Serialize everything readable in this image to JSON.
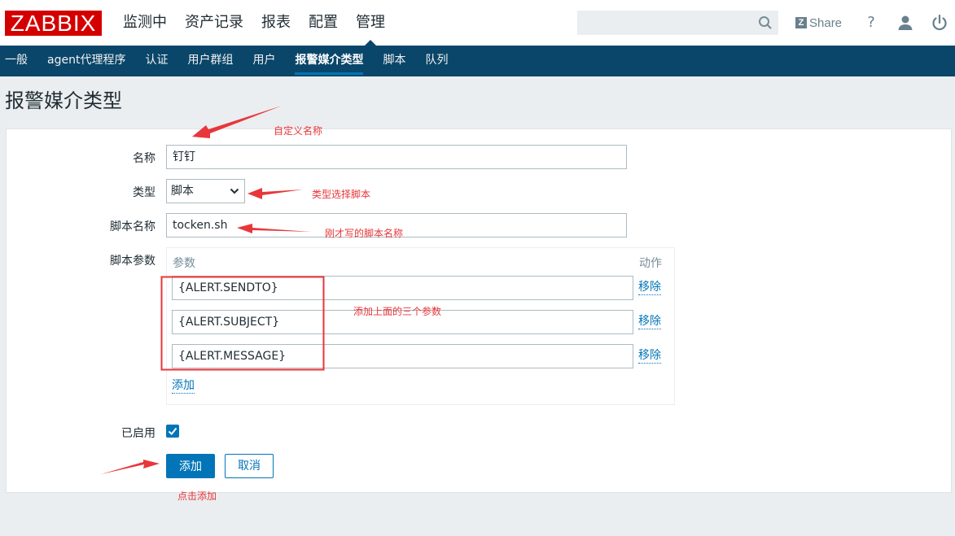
{
  "header": {
    "logo": "ZABBIX",
    "menu": [
      "监测中",
      "资产记录",
      "报表",
      "配置",
      "管理"
    ],
    "active_menu": "管理",
    "search_placeholder": "",
    "share_label": "Share",
    "help_label": "?"
  },
  "subnav": {
    "items": [
      "一般",
      "agent代理程序",
      "认证",
      "用户群组",
      "用户",
      "报警媒介类型",
      "脚本",
      "队列"
    ],
    "active": "报警媒介类型"
  },
  "page_title": "报警媒介类型",
  "form": {
    "name_label": "名称",
    "name_value": "钉钉",
    "type_label": "类型",
    "type_value": "脚本",
    "script_name_label": "脚本名称",
    "script_name_value": "tocken.sh",
    "script_params_label": "脚本参数",
    "params_header": "参数",
    "action_header": "动作",
    "params": [
      {
        "value": "{ALERT.SENDTO}",
        "remove": "移除"
      },
      {
        "value": "{ALERT.SUBJECT}",
        "remove": "移除"
      },
      {
        "value": "{ALERT.MESSAGE}",
        "remove": "移除"
      }
    ],
    "add_param_label": "添加",
    "enabled_label": "已启用",
    "enabled": true,
    "add_button": "添加",
    "cancel_button": "取消"
  },
  "annotations": {
    "custom_name": "自定义名称",
    "type_select": "类型选择脚本",
    "script_name": "刚才写的脚本名称",
    "add_params": "添加上面的三个参数",
    "click_add": "点击添加",
    "color": "#e8363a"
  },
  "colors": {
    "brand_red": "#d40000",
    "nav_bg": "#0a466a",
    "accent": "#0275b8",
    "page_bg": "#ebeef0"
  }
}
